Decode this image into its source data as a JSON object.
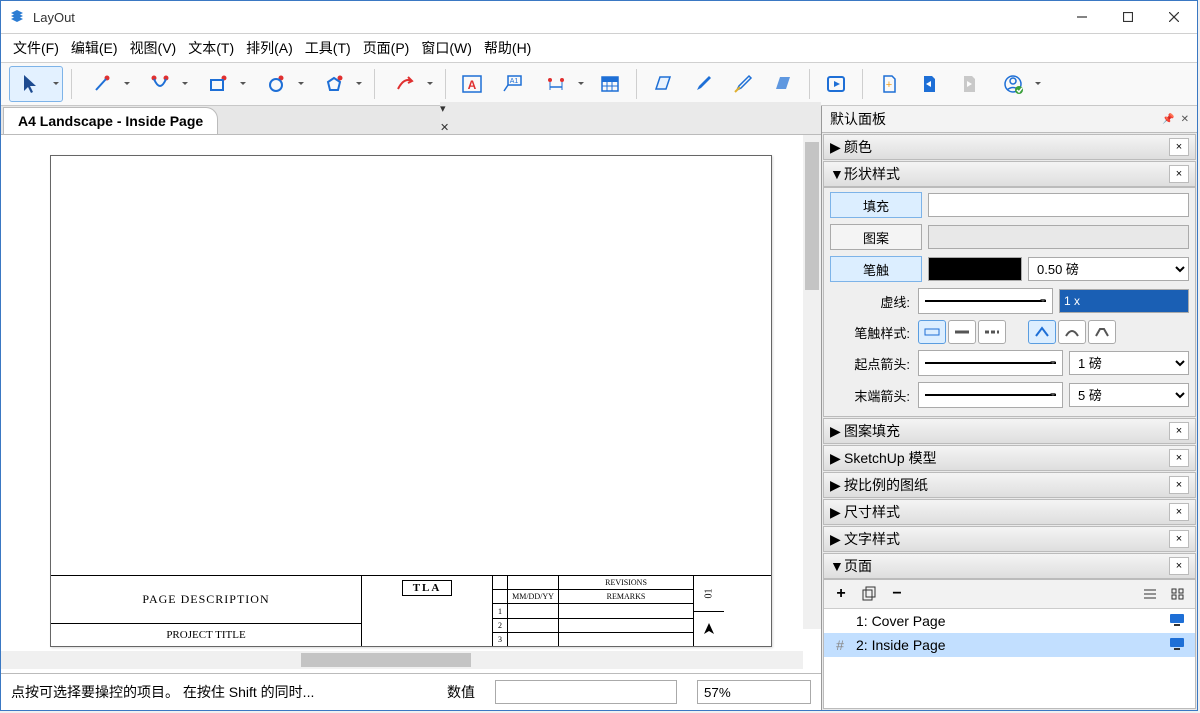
{
  "app": {
    "title": "LayOut"
  },
  "menu": {
    "file": "文件(F)",
    "edit": "编辑(E)",
    "view": "视图(V)",
    "text": "文本(T)",
    "arrange": "排列(A)",
    "tools": "工具(T)",
    "page": "页面(P)",
    "window": "窗口(W)",
    "help": "帮助(H)"
  },
  "doc": {
    "tab_title": "A4 Landscape - Inside Page"
  },
  "titleblock": {
    "page_desc": "PAGE DESCRIPTION",
    "project_title": "PROJECT TITLE",
    "logo": "TLA",
    "rev_header": "REVISIONS",
    "rev_date": "MM/DD/YY",
    "rev_remarks": "REMARKS",
    "sheet_no": "01",
    "arrow": "▲"
  },
  "status": {
    "hint": "点按可选择要操控的项目。 在按住 Shift 的同时...",
    "value_label": "数值",
    "zoom": "57%"
  },
  "panels": {
    "tray_title": "默认面板",
    "color": "颜色",
    "shape": "形状样式",
    "pattern_fill": "图案填充",
    "sketchup": "SketchUp 模型",
    "scaled": "按比例的图纸",
    "dim": "尺寸样式",
    "textstyle": "文字样式",
    "pages": "页面"
  },
  "shape": {
    "fill": "填充",
    "pattern": "图案",
    "stroke": "笔触",
    "stroke_width": "0.50 磅",
    "dash": "虚线:",
    "dash_val": "1 x",
    "stroke_style": "笔触样式:",
    "start_arrow": "起点箭头:",
    "start_arrow_size": "1 磅",
    "end_arrow": "末端箭头:",
    "end_arrow_size": "5 磅"
  },
  "pages": {
    "items": [
      {
        "id": "#",
        "label": "1: Cover Page",
        "active": false
      },
      {
        "id": "#",
        "label": "2: Inside Page",
        "active": true
      }
    ]
  }
}
